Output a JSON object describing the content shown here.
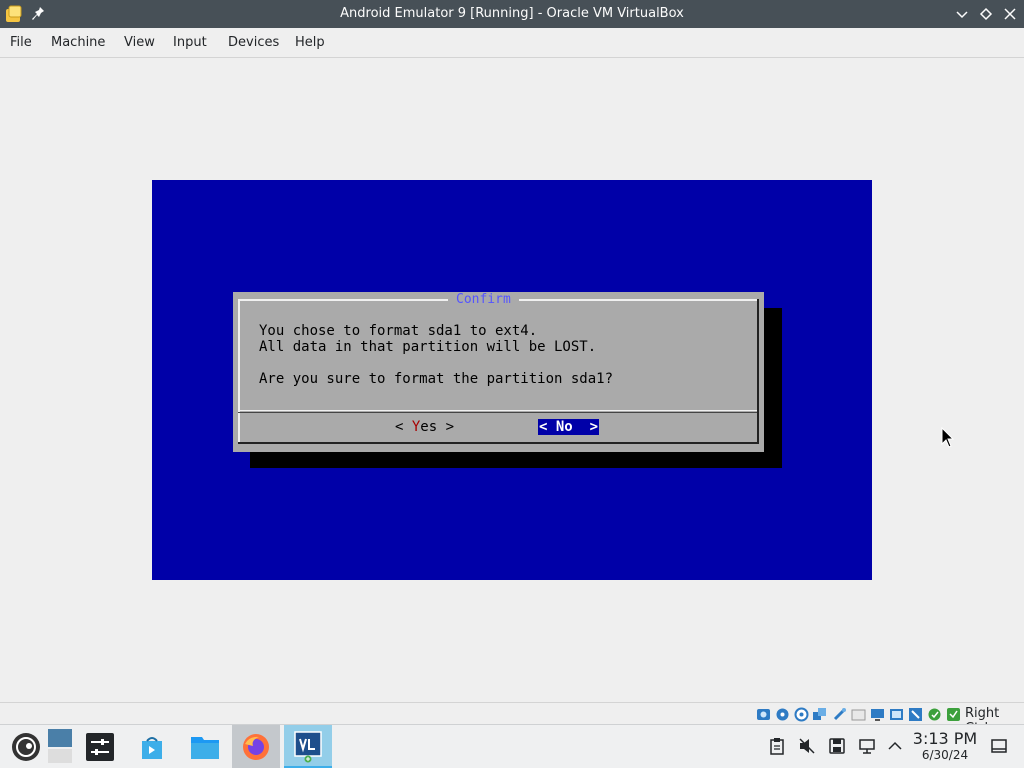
{
  "window": {
    "title": "Android Emulator 9 [Running] - Oracle VM VirtualBox"
  },
  "menu": [
    "File",
    "Machine",
    "View",
    "Input",
    "Devices",
    "Help"
  ],
  "dialog": {
    "title": "Confirm",
    "line1": "You chose to format sda1 to ext4.",
    "line2": "All data in that partition will be LOST.",
    "line3": "Are you sure to format the partition sda1?",
    "yes_prefix": "< ",
    "yes_hotkey": "Y",
    "yes_rest": "es >",
    "no_label": "< No  >",
    "selected_button": "No"
  },
  "vbox_status": {
    "host_key": "Right Ctrl",
    "icons": [
      "hard-disk-icon",
      "optical-drive-icon",
      "audio-icon",
      "network-icon",
      "usb-icon",
      "shared-folders-icon",
      "display-icon",
      "video-capture-icon",
      "mouse-integration-icon",
      "cpu-icon",
      "keyboard-icon"
    ]
  },
  "taskbar": {
    "apps": [
      "application-launcher",
      "desktop-pager",
      "system-settings",
      "discover",
      "dolphin",
      "firefox",
      "virtualbox"
    ],
    "clock_time": "3:13 PM",
    "clock_date": "6/30/24"
  },
  "colors": {
    "vm_background": "#0000a8",
    "dialog_background": "#aaaaaa",
    "dialog_title": "#5555ff",
    "hotkey": "#a80000",
    "titlebar": "#475057"
  }
}
